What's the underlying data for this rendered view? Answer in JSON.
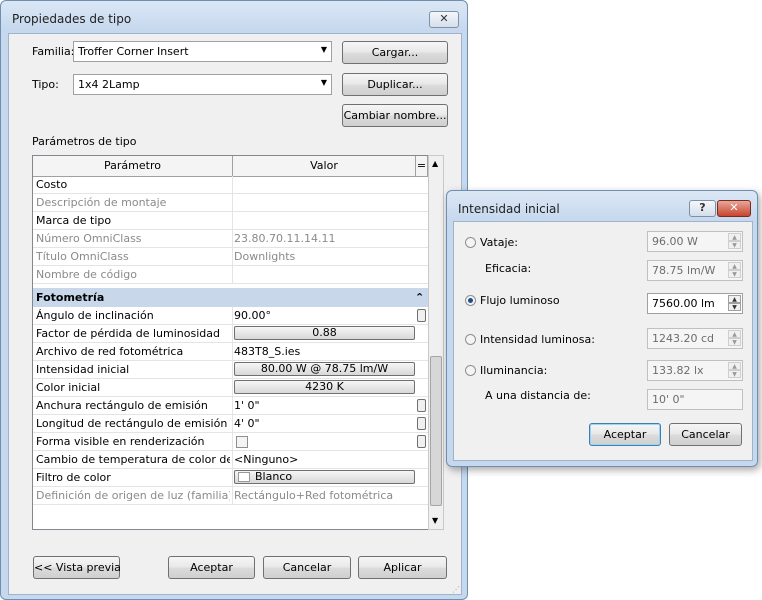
{
  "main": {
    "title": "Propiedades de tipo",
    "close_glyph": "✕",
    "family_label": "Familia:",
    "family_value": "Troffer Corner Insert",
    "type_label": "Tipo:",
    "type_value": "1x4 2Lamp",
    "load_button": "Cargar...",
    "duplicate_button": "Duplicar...",
    "rename_button": "Cambiar nombre...",
    "section_label": "Parámetros de tipo",
    "grid": {
      "header_param": "Parámetro",
      "header_value": "Valor",
      "header_eq": "=",
      "rows_top": [
        {
          "p": "Costo",
          "v": "",
          "dim": false
        },
        {
          "p": "Descripción de montaje",
          "v": "",
          "dim": true
        },
        {
          "p": "Marca de tipo",
          "v": "",
          "dim": false
        },
        {
          "p": "Número OmniClass",
          "v": "23.80.70.11.14.11",
          "dim": true
        },
        {
          "p": "Título OmniClass",
          "v": "Downlights",
          "dim": true
        },
        {
          "p": "Nombre de código",
          "v": "",
          "dim": true
        }
      ],
      "group_label": "Fotometría",
      "group_toggle": "⌃",
      "rows_photo": [
        {
          "p": "Ángulo de inclinación",
          "v": "90.00°"
        },
        {
          "p": "Factor de pérdida de luminosidad",
          "v": "0.88"
        },
        {
          "p": "Archivo de red fotométrica",
          "v": "483T8_S.ies"
        },
        {
          "p": "Intensidad inicial",
          "v": "80.00 W @ 78.75 lm/W"
        },
        {
          "p": "Color inicial",
          "v": "4230 K"
        },
        {
          "p": "Anchura rectángulo de emisión",
          "v": "1'  0\""
        },
        {
          "p": "Longitud de rectángulo de emisión",
          "v": "4'  0\""
        },
        {
          "p": "Forma visible en renderización",
          "v": ""
        },
        {
          "p": "Cambio de temperatura de color de l",
          "v": "<Ninguno>"
        },
        {
          "p": "Filtro de color",
          "v": "Blanco"
        },
        {
          "p": "Definición de origen de luz (familia)",
          "v": "Rectángulo+Red fotométrica"
        }
      ]
    },
    "preview_button": "<< Vista previa",
    "ok_button": "Aceptar",
    "cancel_button": "Cancelar",
    "apply_button": "Aplicar"
  },
  "dialog": {
    "title": "Intensidad inicial",
    "help_glyph": "?",
    "close_glyph": "✕",
    "wattage_label": "Vataje:",
    "wattage_value": "96.00 W",
    "efficacy_label": "Eficacia:",
    "efficacy_value": "78.75 lm/W",
    "flux_label": "Flujo luminoso",
    "flux_value": "7560.00 lm",
    "intensity_label": "Intensidad luminosa:",
    "intensity_value": "1243.20 cd",
    "illuminance_label": "Iluminancia:",
    "illuminance_value": "133.82 lx",
    "distance_label": "A una distancia de:",
    "distance_value": "10'  0\"",
    "ok_button": "Aceptar",
    "cancel_button": "Cancelar",
    "selected_mode": "flux"
  }
}
